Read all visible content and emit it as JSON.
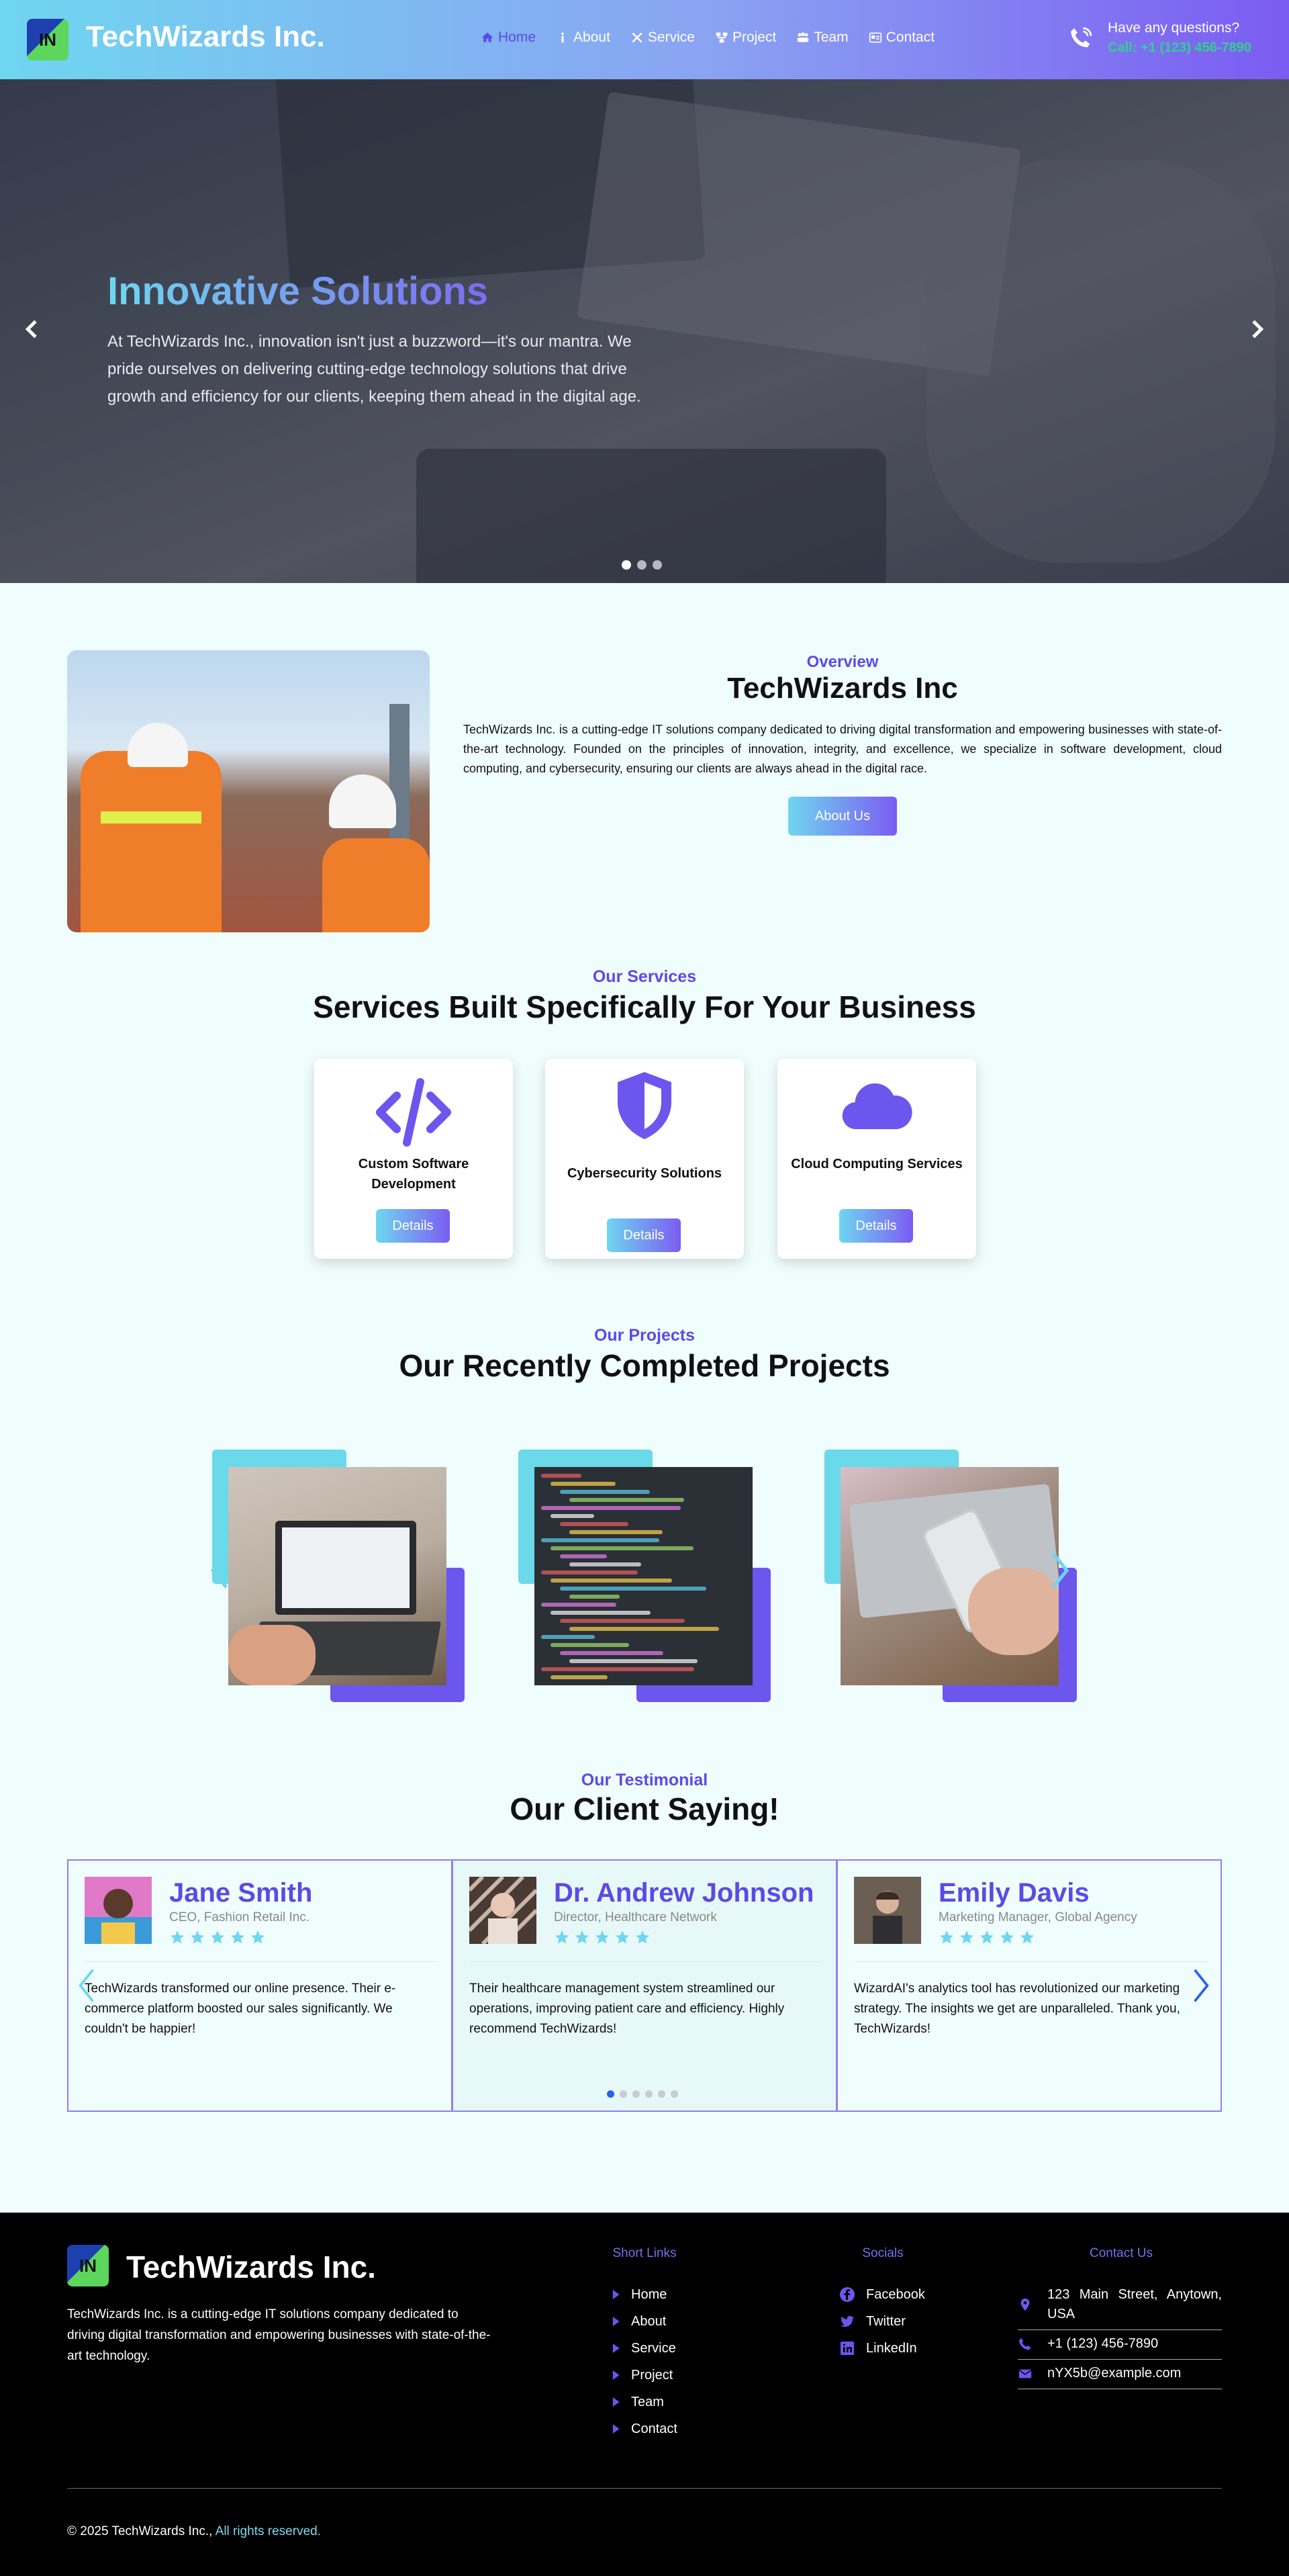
{
  "header": {
    "logo_text": "IN",
    "brand": "TechWizards Inc.",
    "nav": [
      {
        "label": "Home",
        "icon": "home-icon",
        "active": true
      },
      {
        "label": "About",
        "icon": "info-icon"
      },
      {
        "label": "Service",
        "icon": "tools-icon"
      },
      {
        "label": "Project",
        "icon": "project-icon"
      },
      {
        "label": "Team",
        "icon": "team-icon"
      },
      {
        "label": "Contact",
        "icon": "contact-card-icon"
      }
    ],
    "question": "Have any questions?",
    "call": "Call: +1 (123) 456-7890"
  },
  "hero": {
    "title": "Innovative Solutions",
    "text": "At TechWizards Inc., innovation isn't just a buzzword—it's our mantra. We pride ourselves on delivering cutting-edge technology solutions that drive growth and efficiency for our clients, keeping them ahead in the digital age.",
    "slides_total": 3,
    "active_slide": 1
  },
  "overview": {
    "subtitle": "Overview",
    "title": "TechWizards Inc",
    "text": "TechWizards Inc. is a cutting-edge IT solutions company dedicated to driving digital transformation and empowering businesses with state-of-the-art technology. Founded on the principles of innovation, integrity, and excellence, we specialize in software development, cloud computing, and cybersecurity, ensuring our clients are always ahead in the digital race.",
    "button": "About Us"
  },
  "services": {
    "subtitle": "Our Services",
    "title": "Services Built Specifically For Your Business",
    "items": [
      {
        "name": "Custom Software Development",
        "icon": "code-icon",
        "button": "Details"
      },
      {
        "name": "Cybersecurity Solutions",
        "icon": "shield-icon",
        "button": "Details"
      },
      {
        "name": "Cloud Computing Services",
        "icon": "cloud-icon",
        "button": "Details"
      }
    ]
  },
  "projects": {
    "subtitle": "Our Projects",
    "title": "Our Recently Completed Projects"
  },
  "testimonials": {
    "subtitle": "Our Testimonial",
    "title": "Our Client Saying!",
    "items": [
      {
        "name": "Jane Smith",
        "role": "CEO, Fashion Retail Inc.",
        "rating": 5,
        "text": "TechWizards transformed our online presence. Their e-commerce platform boosted our sales significantly. We couldn't be happier!"
      },
      {
        "name": "Dr. Andrew Johnson",
        "role": "Director, Healthcare Network",
        "rating": 5,
        "text": "Their healthcare management system streamlined our operations, improving patient care and efficiency. Highly recommend TechWizards!"
      },
      {
        "name": "Emily Davis",
        "role": "Marketing Manager, Global Agency",
        "rating": 5,
        "text": "WizardAI's analytics tool has revolutionized our marketing strategy. The insights we get are unparalleled. Thank you, TechWizards!"
      }
    ],
    "pages_total": 6,
    "active_page": 1
  },
  "footer": {
    "logo_text": "IN",
    "brand": "TechWizards Inc.",
    "description": "TechWizards Inc. is a cutting-edge IT solutions company dedicated to driving digital transformation and empowering businesses with state-of-the-art technology.",
    "links_heading": "Short Links",
    "links": [
      "Home",
      "About",
      "Service",
      "Project",
      "Team",
      "Contact"
    ],
    "socials_heading": "Socials",
    "socials": [
      {
        "label": "Facebook",
        "icon": "facebook-icon"
      },
      {
        "label": "Twitter",
        "icon": "twitter-icon"
      },
      {
        "label": "LinkedIn",
        "icon": "linkedin-icon"
      }
    ],
    "contact_heading": "Contact Us",
    "address": "123 Main Street, Anytown, USA",
    "phone": "+1 (123) 456-7890",
    "email": "nYX5b@example.com",
    "copyright": "© 2025 TechWizards Inc.,",
    "rights": "All rights reserved."
  },
  "colors": {
    "accent": "#5b4ae6",
    "cyan": "#6fd6f0",
    "call_green": "#2fd38a",
    "footer_bg": "#000000"
  }
}
